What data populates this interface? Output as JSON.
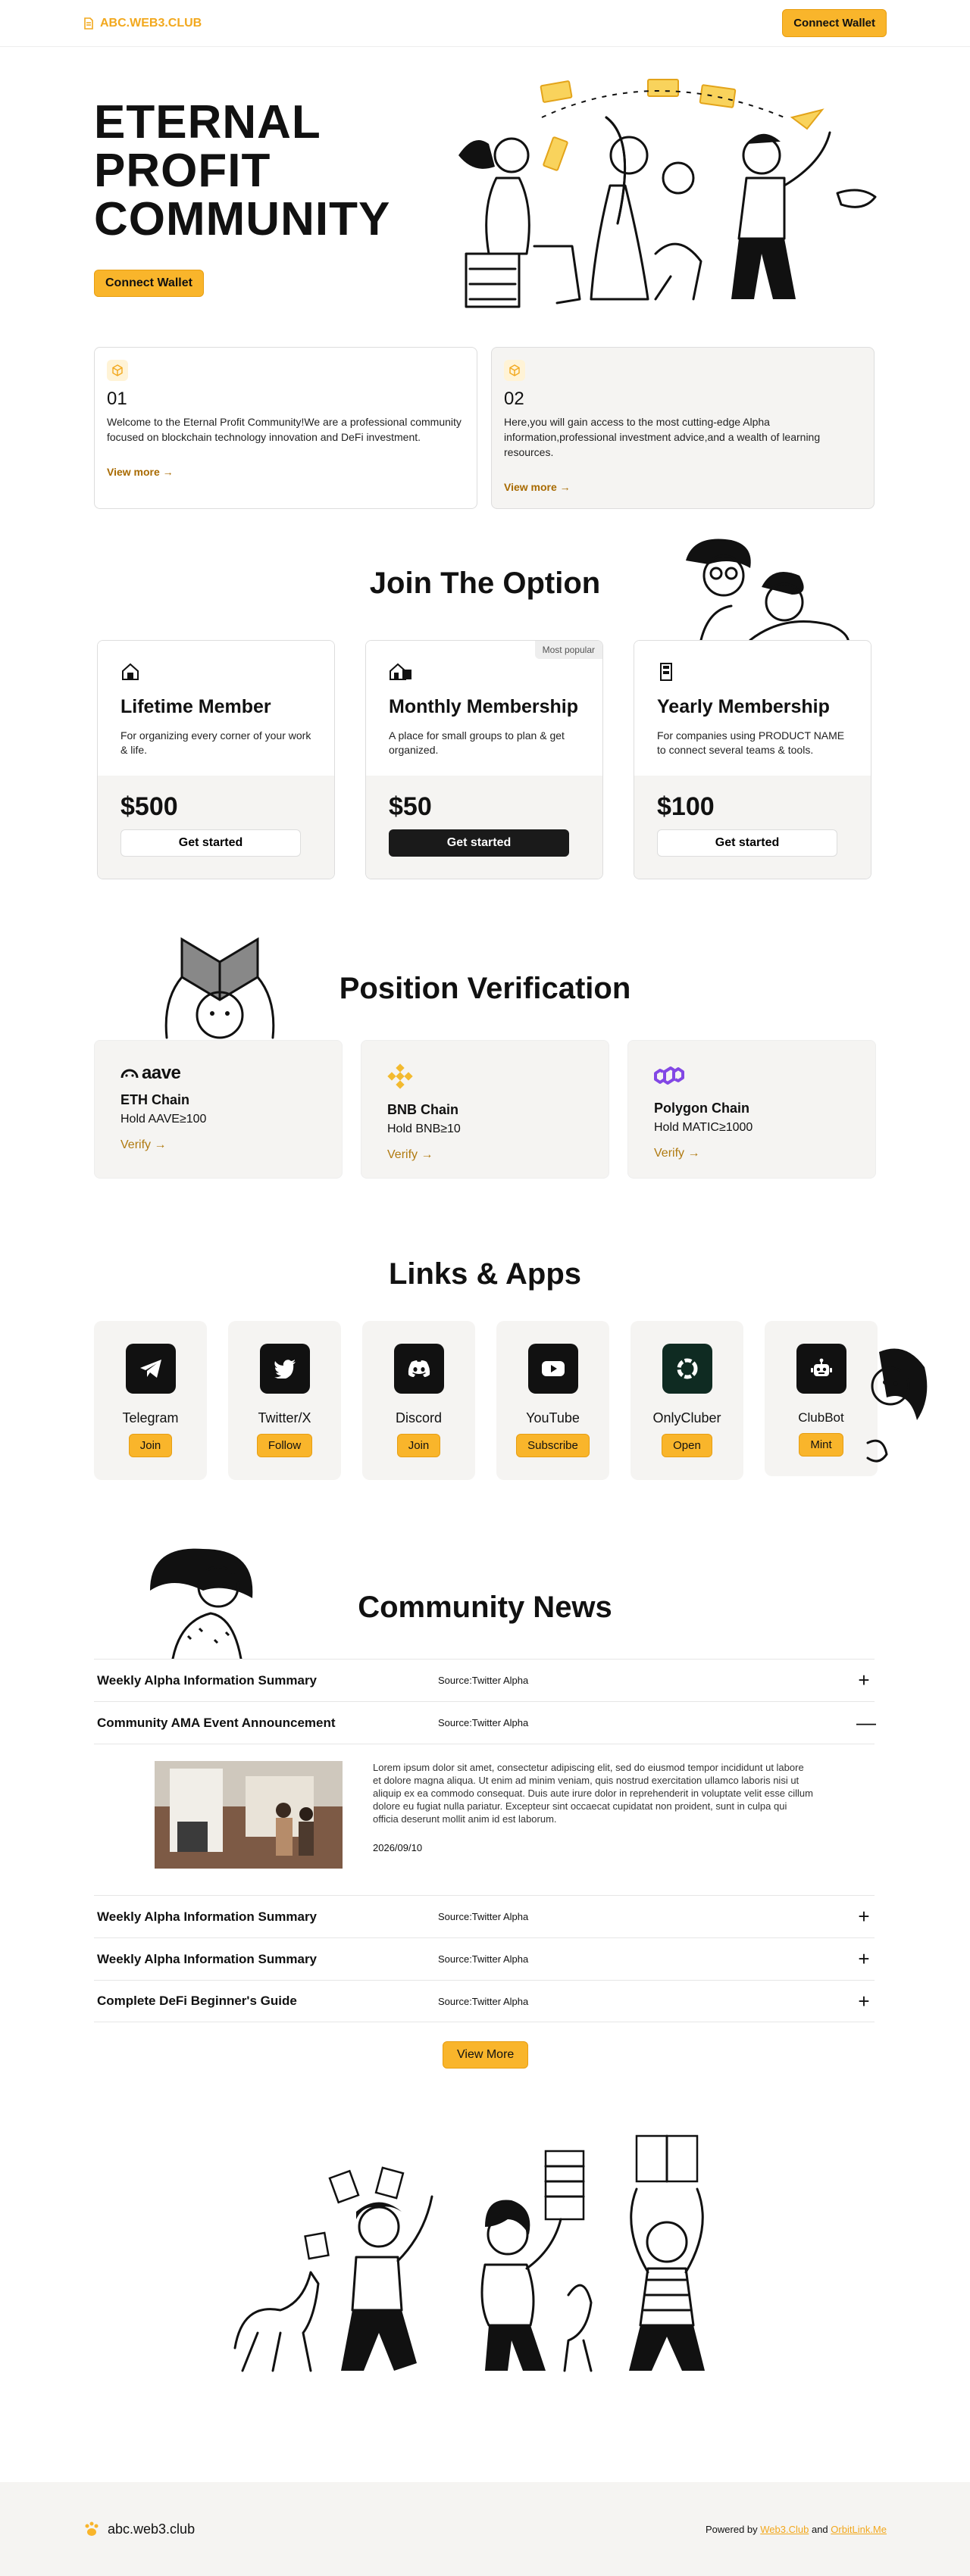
{
  "nav": {
    "brand": "ABC.WEB3.CLUB",
    "connect": "Connect Wallet"
  },
  "hero": {
    "line1": "ETERNAL",
    "line2": "PROFIT",
    "line3": "COMMUNITY",
    "connect": "Connect Wallet"
  },
  "intro": [
    {
      "num": "01",
      "text": "Welcome to the Eternal Profit Community!We are a professional community focused on blockchain technology innovation and DeFi investment.",
      "link": "View more →"
    },
    {
      "num": "02",
      "text": "Here,you will gain access to the most cutting-edge Alpha information,professional investment advice,and a wealth of learning resources.",
      "link": "View more →"
    }
  ],
  "options": {
    "title": "Join The Option",
    "plans": [
      {
        "name": "Lifetime Member",
        "desc": "For organizing every corner of your work & life.",
        "price": "$500",
        "cta": "Get started",
        "badge": ""
      },
      {
        "name": "Monthly Membership",
        "desc": "A place for small groups to plan & get organized.",
        "price": "$50",
        "cta": "Get started",
        "badge": "Most popular"
      },
      {
        "name": "Yearly Membership",
        "desc": "For companies using PRODUCT NAME to connect several teams & tools.",
        "price": "$100",
        "cta": "Get started",
        "badge": ""
      }
    ]
  },
  "verification": {
    "title": "Position Verification",
    "chains": [
      {
        "logo": "aave",
        "name": "ETH Chain",
        "hold": "Hold AAVE≥100",
        "link": "Verify →"
      },
      {
        "logo": "",
        "name": "BNB Chain",
        "hold": "Hold BNB≥10",
        "link": "Verify →"
      },
      {
        "logo": "",
        "name": "Polygon Chain",
        "hold": "Hold MATIC≥1000",
        "link": "Verify →"
      }
    ]
  },
  "apps": {
    "title": "Links & Apps",
    "items": [
      {
        "name": "Telegram",
        "cta": "Join",
        "icon": "telegram-icon"
      },
      {
        "name": "Twitter/X",
        "cta": "Follow",
        "icon": "twitter-icon"
      },
      {
        "name": "Discord",
        "cta": "Join",
        "icon": "discord-icon"
      },
      {
        "name": "YouTube",
        "cta": "Subscribe",
        "icon": "youtube-icon"
      },
      {
        "name": "OnlyCluber",
        "cta": "Open",
        "icon": "onlycluber-icon"
      },
      {
        "name": "ClubBot",
        "cta": "Mint",
        "icon": "robot-icon"
      }
    ]
  },
  "news": {
    "title": "Community News",
    "items": [
      {
        "title": "Weekly Alpha Information Summary",
        "source": "Source:Twitter Alpha",
        "toggle": "+"
      },
      {
        "title": "Community AMA Event Announcement",
        "source": "Source:Twitter Alpha",
        "toggle": "—"
      },
      {
        "title": "Weekly Alpha Information Summary",
        "source": "Source:Twitter Alpha",
        "toggle": "+"
      },
      {
        "title": "Weekly Alpha Information Summary",
        "source": "Source:Twitter Alpha",
        "toggle": "+"
      },
      {
        "title": "Complete DeFi Beginner's Guide",
        "source": "Source:Twitter Alpha",
        "toggle": "+"
      }
    ],
    "expanded": {
      "body": "Lorem ipsum dolor sit amet, consectetur adipiscing elit, sed do eiusmod tempor incididunt ut labore et dolore magna aliqua. Ut enim ad minim veniam, quis nostrud exercitation ullamco laboris nisi ut aliquip ex ea commodo consequat. Duis aute irure dolor in reprehenderit in voluptate velit esse cillum dolore eu fugiat nulla pariatur. Excepteur sint occaecat cupidatat non proident, sunt in culpa qui officia deserunt mollit anim id est laborum.",
      "date": "2026/09/10"
    },
    "view_more": "View More"
  },
  "footer": {
    "brand": "abc.web3.club",
    "powered_prefix": "Powered by",
    "link1": "Web3.Club",
    "and": "and",
    "link2": "OrbitLink.Me"
  },
  "colors": {
    "accent": "#f9b52b",
    "brand_text": "#f2a81d",
    "panel": "#f5f4f2",
    "bnb": "#f3ba2f",
    "polygon": "#8247e5"
  }
}
